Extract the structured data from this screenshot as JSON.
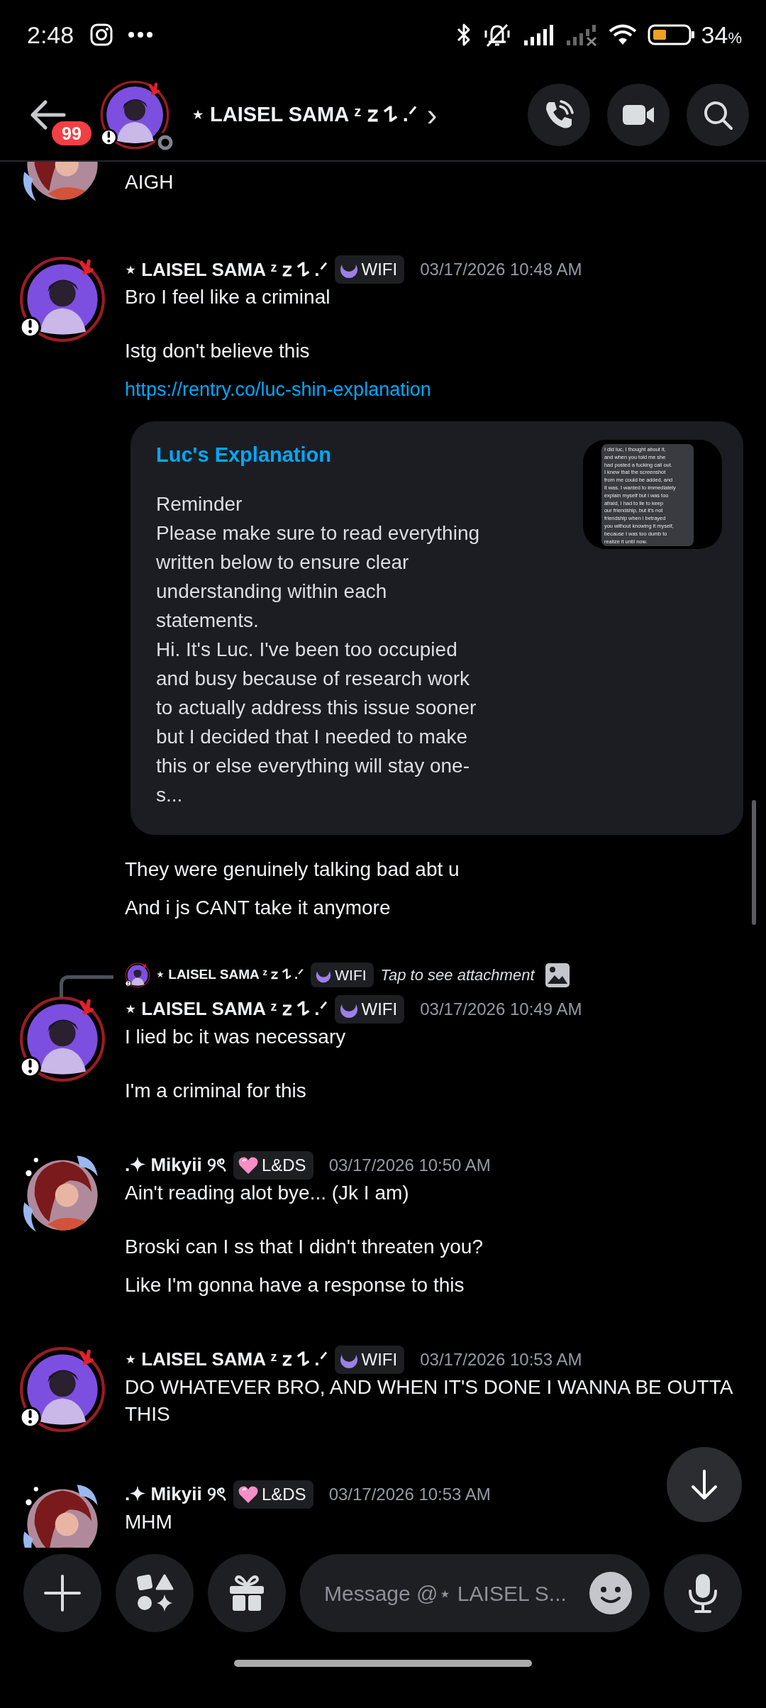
{
  "status_bar": {
    "time": "2:48",
    "battery": "34",
    "battery_unit": "%"
  },
  "header": {
    "unread_badge": "99",
    "title": "⋆ LAISEL SAMA ᶻ 𝗓 𐰁 .ᐟ",
    "chevron": "›"
  },
  "messages": [
    {
      "kind": "tail",
      "blocks": [
        {
          "kind": "text",
          "text": "AIGH"
        }
      ]
    },
    {
      "kind": "message",
      "author": "⋆ LAISEL SAMA ᶻ 𝗓 𐰁 .ᐟ",
      "tag": {
        "label": "WIFI"
      },
      "time": "03/17/2026 10:48 AM",
      "blocks": [
        {
          "kind": "text",
          "text": "Bro I feel like a criminal\n\nIstg don't believe this"
        },
        {
          "kind": "link",
          "text": "https://rentry.co/luc-shin-explanation"
        },
        {
          "kind": "embed",
          "title": "Luc's Explanation",
          "description": "Reminder\nPlease make sure to read everything written below to ensure clear understanding within each statements.\nHi. It's Luc. I've been too occupied and busy because of research work to actually address this issue sooner but I decided that I needed to make this or else everything will stay one-s...",
          "thumbnail_text": "I did luc, I thought about it,\nand when you told me she\nhad posted a fucking call out.\nI knew that the screenshot\nfrom me could be added, and\nit was. I wanted to immediately\nexplain myself but i was too\nafraid, I had to lie to keep\nour friendship, but it's not\nfriendship when i betrayed\nyou without knowing it myself,\nbecause I was too dumb to\nrealize it until now."
        },
        {
          "kind": "text",
          "text": "They were genuinely talking bad abt u"
        },
        {
          "kind": "text",
          "text": "And i js CANT take it anymore"
        }
      ]
    },
    {
      "kind": "message",
      "reply": {
        "author": "⋆ LAISEL SAMA ᶻ 𝗓 𐰁 .ᐟ",
        "tag": {
          "label": "WIFI"
        },
        "text": "Tap to see attachment"
      },
      "author": "⋆ LAISEL SAMA ᶻ 𝗓 𐰁 .ᐟ",
      "tag": {
        "label": "WIFI"
      },
      "time": "03/17/2026 10:49 AM",
      "blocks": [
        {
          "kind": "text",
          "text": "I lied bc it was necessary\n\nI'm a criminal for this"
        }
      ]
    },
    {
      "kind": "message",
      "author": ".✦ Mikyii ୨ৎ",
      "tag": {
        "label": "L&DS"
      },
      "time": "03/17/2026 10:50 AM",
      "blocks": [
        {
          "kind": "text",
          "text": "Ain't reading alot bye... (Jk I am)\n\nBroski can I ss that I didn't threaten you?"
        },
        {
          "kind": "text",
          "text": "Like I'm gonna have a response to this"
        }
      ]
    },
    {
      "kind": "message",
      "author": "⋆ LAISEL SAMA ᶻ 𝗓 𐰁 .ᐟ",
      "tag": {
        "label": "WIFI"
      },
      "time": "03/17/2026 10:53 AM",
      "blocks": [
        {
          "kind": "text",
          "text": "DO WHATEVER BRO, AND WHEN IT'S DONE I WANNA BE OUTTA THIS"
        }
      ]
    },
    {
      "kind": "message",
      "author": ".✦ Mikyii ୨ৎ",
      "tag": {
        "label": "L&DS"
      },
      "time": "03/17/2026 10:53 AM",
      "blocks": [
        {
          "kind": "text",
          "text": "MHM"
        }
      ]
    }
  ],
  "composer": {
    "placeholder": "Message @⋆ LAISEL S..."
  }
}
